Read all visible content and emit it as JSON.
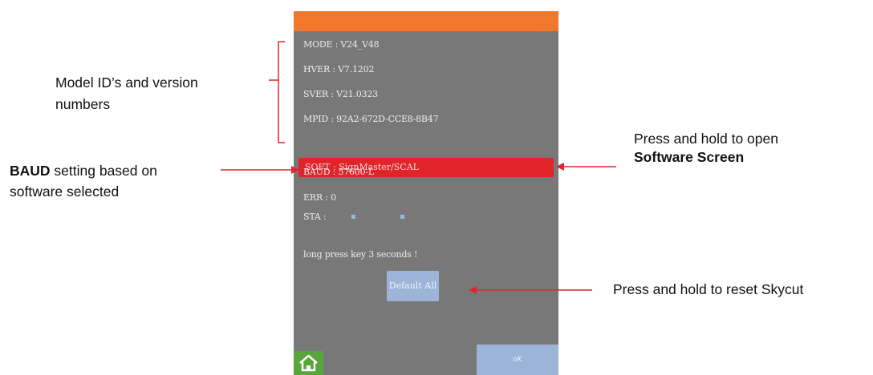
{
  "device": {
    "rows": {
      "mode": "MODE : V24_V48",
      "hver": "HVER : V7.1202",
      "sver": "SVER : V21.0323",
      "mpid": "MPID : 92A2-672D-CCE8-8B47",
      "soft": "SOFT : SignMaster/SCAL",
      "baud": "BAUD : 57600-L",
      "err": "ERR : 0",
      "sta": "STA :"
    },
    "hint": "long press key 3 seconds !",
    "default_button": "Default All",
    "ok_button": "oK"
  },
  "callouts": {
    "model_line1": "Model ID’s and version",
    "model_line2": "numbers",
    "baud_bold": "BAUD",
    "baud_rest": " setting based on",
    "baud_line2": "software selected",
    "software_line1": "Press and hold to open",
    "software_line2": "Software Screen",
    "reset": "Press and hold to reset Skycut"
  },
  "colors": {
    "accent_bar": "#f1782a",
    "soft_highlight": "#e1232a",
    "arrow": "#e0262c",
    "screen_bg": "#787878",
    "button": "#9cb4d8",
    "home_button": "#57a63a"
  },
  "icons": {
    "home": "home-icon"
  }
}
